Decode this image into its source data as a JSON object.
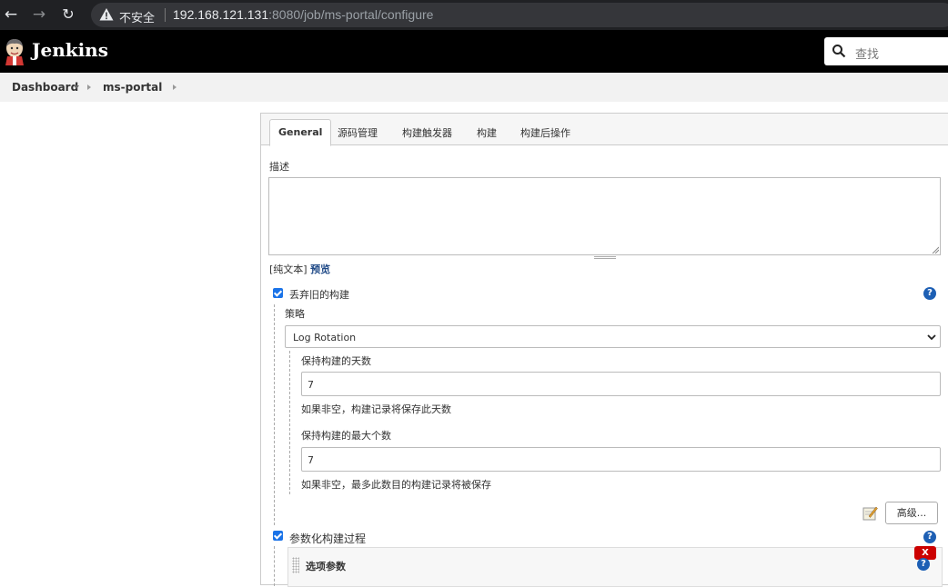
{
  "browser": {
    "insecure_label": "不安全",
    "url_host": "192.168.121.131",
    "url_rest": ":8080/job/ms-portal/configure"
  },
  "header": {
    "brand": "Jenkins",
    "search_placeholder": "查找"
  },
  "breadcrumb": {
    "items": [
      "Dashboard",
      "ms-portal"
    ]
  },
  "tabs": [
    "General",
    "源码管理",
    "构建触发器",
    "构建",
    "构建后操作"
  ],
  "general": {
    "description_label": "描述",
    "description_value": "",
    "plain_text_label": "[纯文本]",
    "preview_link": "预览",
    "discard_old_builds": {
      "label": "丢弃旧的构建",
      "checked": true,
      "strategy_label": "策略",
      "strategy_value": "Log Rotation",
      "days_label": "保持构建的天数",
      "days_value": "7",
      "days_hint": "如果非空，构建记录将保存此天数",
      "max_label": "保持构建的最大个数",
      "max_value": "7",
      "max_hint": "如果非空，最多此数目的构建记录将被保存",
      "advanced_button": "高级..."
    },
    "parameterized": {
      "label": "参数化构建过程",
      "checked": true,
      "param_title": "选项参数",
      "delete_button": "X"
    },
    "help_glyph": "?"
  },
  "colors": {
    "header_bg": "#000000",
    "checkbox": "#1a73e8",
    "help": "#1d5fb4",
    "delete": "#cc0000"
  }
}
